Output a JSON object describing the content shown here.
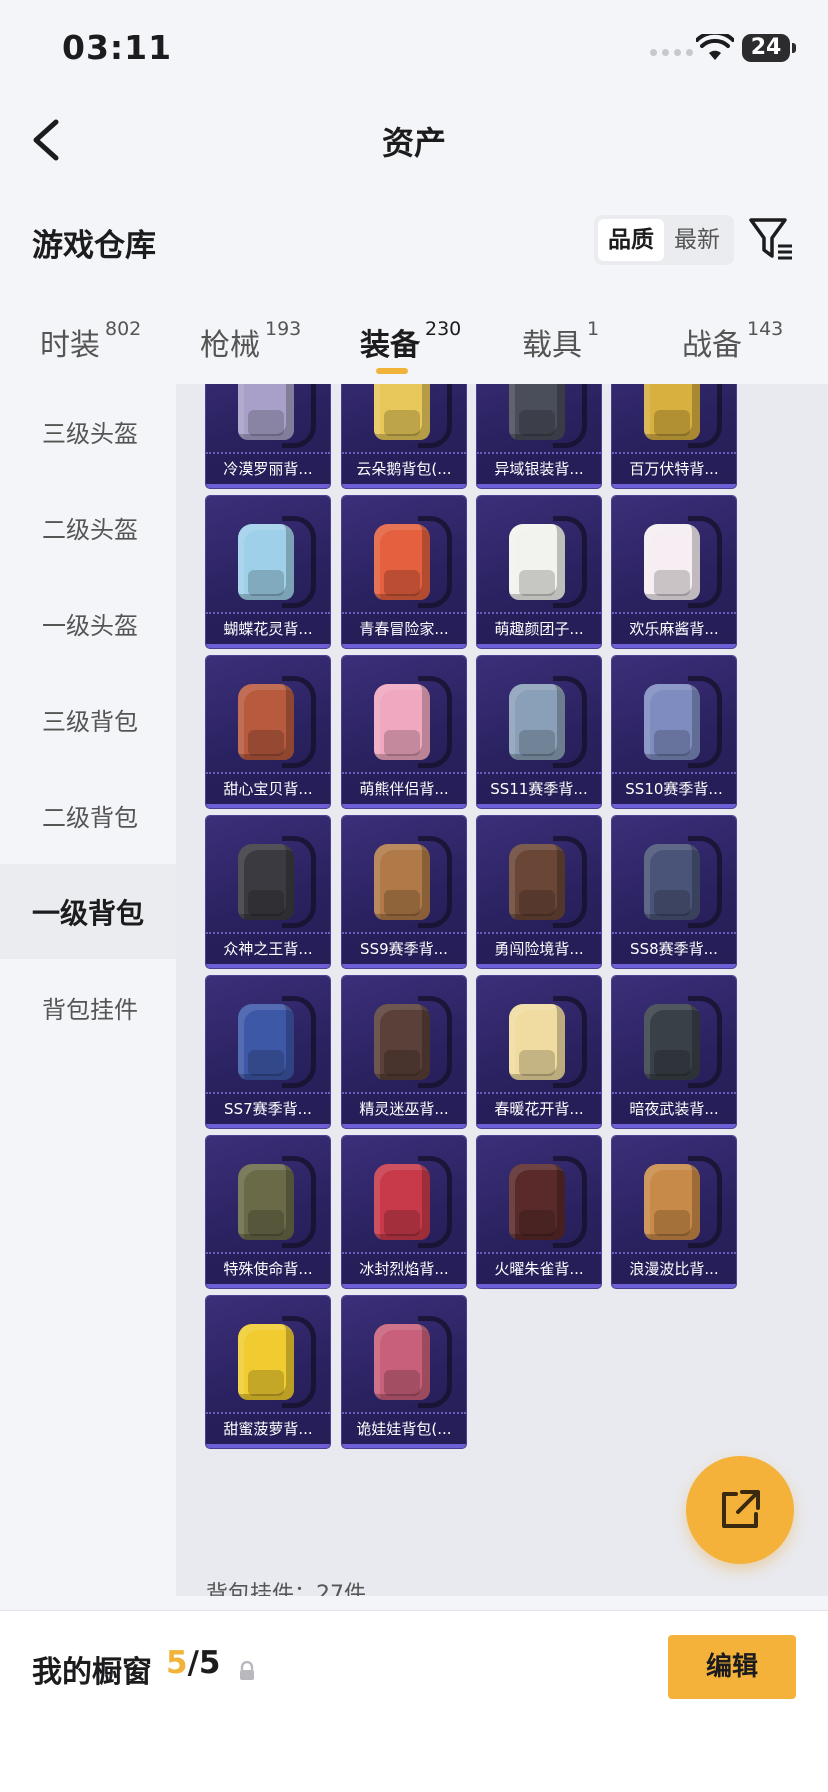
{
  "status": {
    "time": "03:11",
    "battery": "24"
  },
  "nav": {
    "title": "资产"
  },
  "section": {
    "title": "游戏仓库",
    "sort_quality": "品质",
    "sort_latest": "最新"
  },
  "tabs": [
    {
      "label": "时装",
      "count": "802"
    },
    {
      "label": "枪械",
      "count": "193"
    },
    {
      "label": "装备",
      "count": "230"
    },
    {
      "label": "载具",
      "count": "1"
    },
    {
      "label": "战备",
      "count": "143"
    }
  ],
  "sidebar": [
    "三级头盔",
    "二级头盔",
    "一级头盔",
    "三级背包",
    "二级背包",
    "一级背包",
    "背包挂件"
  ],
  "items": [
    {
      "label": "冷漠罗丽背...",
      "color": "#a8a0c8"
    },
    {
      "label": "云朵鹅背包(...",
      "color": "#e8c85a"
    },
    {
      "label": "异域银装背...",
      "color": "#4a4e5a"
    },
    {
      "label": "百万伏特背...",
      "color": "#d8b040"
    },
    {
      "label": "蝴蝶花灵背...",
      "color": "#9fd0ea"
    },
    {
      "label": "青春冒险家...",
      "color": "#e4603e"
    },
    {
      "label": "萌趣颜团子...",
      "color": "#f2f2ee"
    },
    {
      "label": "欢乐麻酱背...",
      "color": "#f6eef2"
    },
    {
      "label": "甜心宝贝背...",
      "color": "#b85a3e"
    },
    {
      "label": "萌熊伴侣背...",
      "color": "#f0a8c0"
    },
    {
      "label": "SS11赛季背...",
      "color": "#8aa0b8"
    },
    {
      "label": "SS10赛季背...",
      "color": "#7e8cc0"
    },
    {
      "label": "众神之王背...",
      "color": "#3a3a40"
    },
    {
      "label": "SS9赛季背...",
      "color": "#b07a48"
    },
    {
      "label": "勇闯险境背...",
      "color": "#6a4636"
    },
    {
      "label": "SS8赛季背...",
      "color": "#4a5478"
    },
    {
      "label": "SS7赛季背...",
      "color": "#3e58a8"
    },
    {
      "label": "精灵迷巫背...",
      "color": "#5a4038"
    },
    {
      "label": "春暖花开背...",
      "color": "#f0dca0"
    },
    {
      "label": "暗夜武装背...",
      "color": "#3a4048"
    },
    {
      "label": "特殊使命背...",
      "color": "#6a6a48"
    },
    {
      "label": "冰封烈焰背...",
      "color": "#c83a4a"
    },
    {
      "label": "火曜朱雀背...",
      "color": "#5a2a2a"
    },
    {
      "label": "浪漫波比背...",
      "color": "#c88a48"
    },
    {
      "label": "甜蜜菠萝背...",
      "color": "#f0cc30"
    },
    {
      "label": "诡娃娃背包(...",
      "color": "#c8607a"
    }
  ],
  "more_text": "背包挂件：27件",
  "showcase": {
    "title": "我的橱窗",
    "count_current": "5",
    "count_total": "/5",
    "edit_label": "编辑"
  },
  "colors": {
    "accent": "#f2b33a",
    "card_bg": "#2a2260",
    "card_border": "#6d5fd6"
  }
}
